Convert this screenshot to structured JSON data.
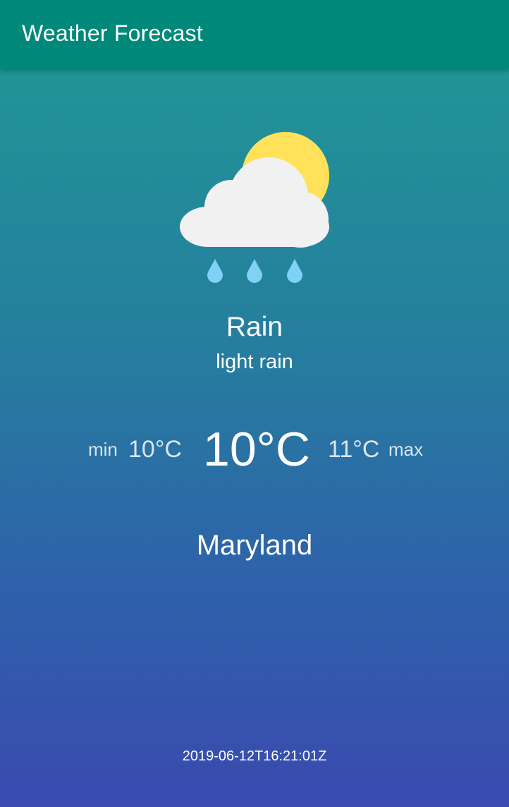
{
  "app_bar": {
    "title": "Weather Forecast",
    "color": "#00897b"
  },
  "weather": {
    "icon": "cloud-sun-rain-icon",
    "condition": "Rain",
    "description": "light rain",
    "min_label": "min",
    "min_temp": "10°C",
    "current_temp": "10°C",
    "max_temp": "11°C",
    "max_label": "max",
    "location": "Maryland",
    "timestamp": "2019-06-12T16:21:01Z"
  },
  "colors": {
    "gradient_top": "#1f9a94",
    "gradient_bottom": "#3a4ab0",
    "sun": "#ffe15a",
    "cloud": "#f1f1f2",
    "raindrop": "#7fd2f5"
  }
}
